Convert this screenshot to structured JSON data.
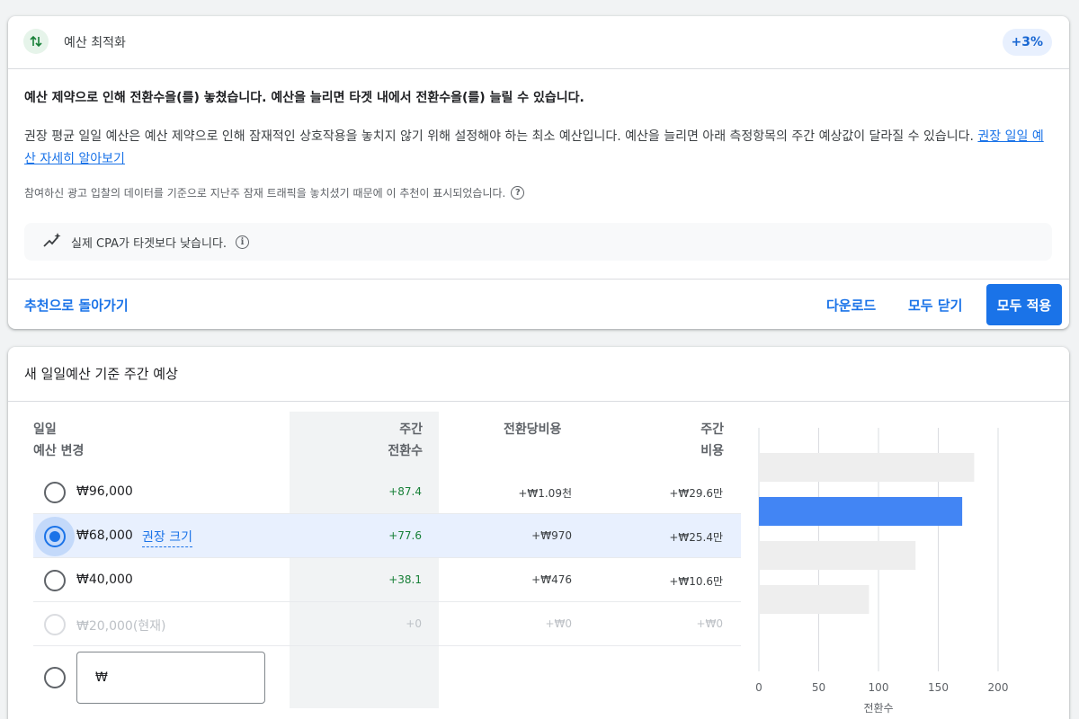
{
  "card": {
    "title": "예산 최적화",
    "badge": "+3%",
    "headline": "예산 제약으로 인해 전환수을(를) 놓쳤습니다. 예산을 늘리면 타겟 내에서 전환수을(를) 늘릴 수 있습니다.",
    "para_text": "권장 평균 일일 예산은 예산 제약으로 인해 잠재적인 상호작용을 놓치지 않기 위해 설정해야 하는 최소 예산입니다. 예산을 늘리면 아래 측정항목의 주간 예상값이 달라질 수 있습니다. ",
    "para_link": "권장 일일 예산 자세히 알아보기",
    "note": "참여하신 광고 입찰의 데이터를 기준으로 지난주 잠재 트래픽을 놓치셨기 때문에 이 추천이 표시되었습니다.",
    "info": "실제 CPA가 타겟보다 낮습니다.",
    "back_label": "추천으로 돌아가기",
    "download_label": "다운로드",
    "dismiss_all_label": "모두 닫기",
    "apply_all_label": "모두 적용"
  },
  "forecast": {
    "title": "새 일일예산 기준 주간 예상",
    "headers": {
      "budget_l1": "일일",
      "budget_l2": "예산 변경",
      "conv_l1": "주간",
      "conv_l2": "전환수",
      "cpa": "전환당비용",
      "cost_l1": "주간",
      "cost_l2": "비용"
    },
    "rows": [
      {
        "amount": "₩96,000",
        "conv": "+87.4",
        "cpa": "+₩1.09천",
        "cost": "+₩29.6만"
      },
      {
        "amount": "₩68,000",
        "tag": "권장 크기",
        "conv": "+77.6",
        "cpa": "+₩970",
        "cost": "+₩25.4만"
      },
      {
        "amount": "₩40,000",
        "conv": "+38.1",
        "cpa": "+₩476",
        "cost": "+₩10.6만"
      },
      {
        "amount": "₩20,000(현재)",
        "conv": "+0",
        "cpa": "+₩0",
        "cost": "+₩0"
      }
    ],
    "custom_prefix": "₩"
  },
  "chart_data": {
    "type": "bar",
    "orientation": "horizontal",
    "categories": [
      "₩96,000",
      "₩68,000",
      "₩40,000",
      "₩20,000(현재)"
    ],
    "values": [
      180,
      170,
      131,
      92
    ],
    "highlight_index": 1,
    "xlabel": "전환수",
    "xlim": [
      0,
      200
    ],
    "xticks": [
      0,
      50,
      100,
      150,
      200
    ],
    "grid": true,
    "colors": {
      "default": "#eeeeee",
      "highlight": "#4285f4"
    }
  },
  "colors": {
    "accent": "#1a73e8",
    "positive": "#188038"
  }
}
